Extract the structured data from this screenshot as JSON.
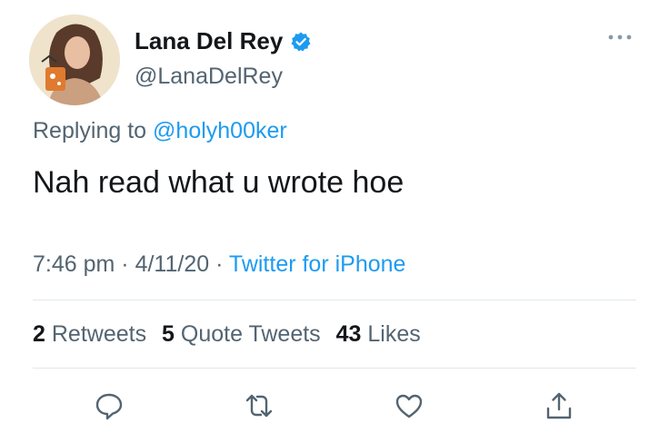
{
  "author": {
    "display_name": "Lana Del Rey",
    "handle": "@LanaDelRey",
    "verified": true,
    "avatar": "profile-photo"
  },
  "reply": {
    "prefix": "Replying to",
    "mention": "@holyh00ker"
  },
  "tweet": {
    "text": "Nah read what u wrote hoe"
  },
  "meta": {
    "time": "7:46 pm",
    "date": "4/11/20",
    "source": "Twitter for iPhone",
    "separator": "·"
  },
  "stats": {
    "retweets_count": "2",
    "retweets_label": "Retweets",
    "quotes_count": "5",
    "quotes_label": "Quote Tweets",
    "likes_count": "43",
    "likes_label": "Likes"
  },
  "actions": [
    "reply-icon",
    "retweet-icon",
    "like-icon",
    "share-icon"
  ],
  "colors": {
    "accent": "#1d9bf0",
    "secondary_text": "#536471",
    "primary_text": "#14171a",
    "divider": "#e1e8ed"
  }
}
